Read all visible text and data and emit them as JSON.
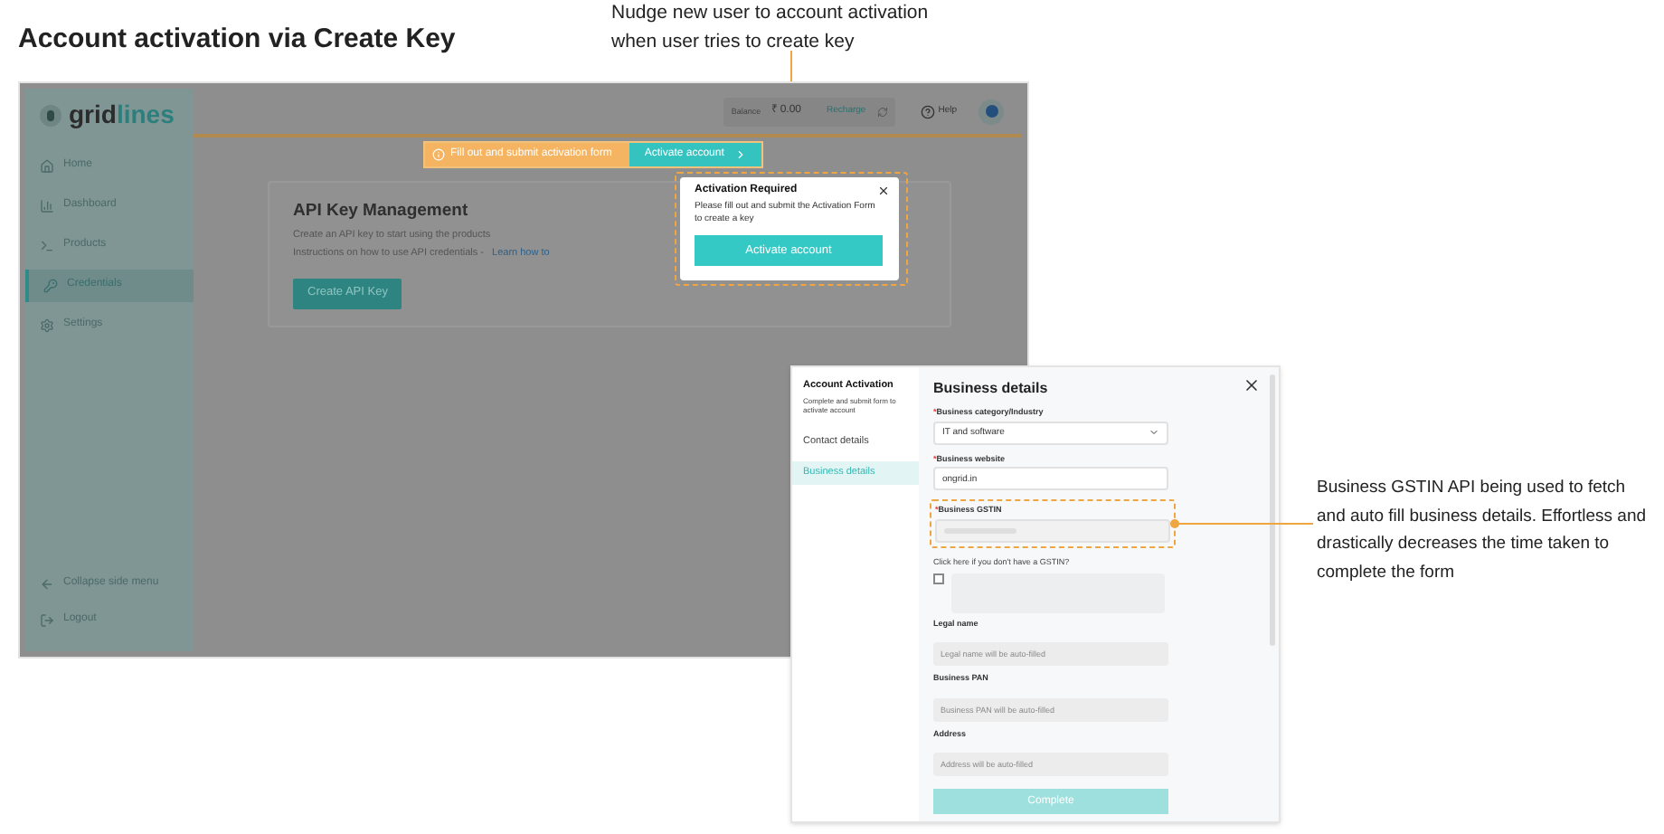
{
  "title": "Account activation via Create Key",
  "annotations": [
    {
      "text": "Nudge new user to account activation when user tries to create key"
    },
    {
      "text": "Business GSTIN API being used to fetch and auto fill business details. Effortless and drastically decreases the time taken to complete the form"
    }
  ],
  "dashboard": {
    "logo": [
      "grid",
      "lines"
    ],
    "sidebar": {
      "items": [
        {
          "label": "Home",
          "selected": false
        },
        {
          "label": "Dashboard",
          "selected": false
        },
        {
          "label": "Products",
          "selected": false
        },
        {
          "label": "Credentials",
          "selected": true
        },
        {
          "label": "Settings",
          "selected": false
        }
      ],
      "footer_items": [
        {
          "label": "Collapse side menu"
        },
        {
          "label": "Logout"
        }
      ]
    },
    "topbar": {
      "balance_label": "Balance",
      "balance": "₹ 0.00",
      "recharge": "Recharge",
      "help": "Help"
    },
    "banner": {
      "text": "Fill out and submit activation form",
      "button": "Activate account"
    },
    "card": {
      "title": "API Key Management",
      "description": "Create an API key to start using the products",
      "instructions": "Instructions on how to use API credentials - ",
      "link": "Learn how to",
      "button": "Create API Key"
    },
    "popup": {
      "title": "Activation Required",
      "body": "Please fill out and submit the Activation Form to create a key",
      "button": "Activate account"
    }
  },
  "form": {
    "nav": {
      "title": "Account Activation",
      "subtitle": "Complete and submit form to activate account",
      "items": [
        {
          "label": "Contact details",
          "selected": false
        },
        {
          "label": "Business details",
          "selected": true
        }
      ]
    },
    "heading": "Business details",
    "fields": [
      {
        "kind": "select",
        "mark": "*",
        "label": "Business category/Industry",
        "value": "IT and software",
        "highlighted": false
      },
      {
        "kind": "input",
        "mark": "*",
        "label": "Business website",
        "value": "ongrid.in",
        "highlighted": false
      },
      {
        "kind": "input",
        "mark": "*",
        "label": "Business GSTIN",
        "highlighted": true
      }
    ],
    "gstin_hint": "Click here if you don't have a GSTIN?",
    "gstin_checkbox": {
      "checked": false
    },
    "auto_fields": [
      {
        "label": "Legal name",
        "placeholder": "Legal name will be auto-filled"
      },
      {
        "label": "Business PAN",
        "placeholder": "Business PAN will be auto-filled"
      },
      {
        "label": "Address",
        "placeholder": "Address will be auto-filled"
      }
    ],
    "submit": {
      "label": "Complete",
      "disabled": true
    }
  }
}
